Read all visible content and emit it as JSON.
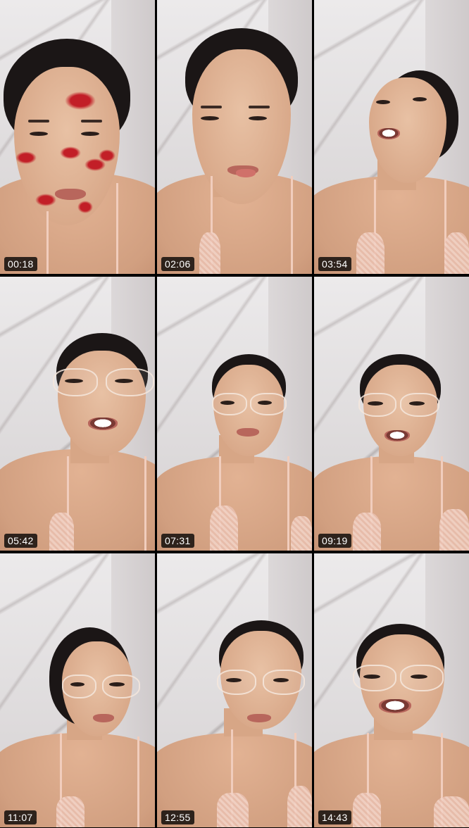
{
  "thumbnails": [
    {
      "timestamp": "00:18",
      "variant": "kiss-filter"
    },
    {
      "timestamp": "02:06",
      "variant": "tongue"
    },
    {
      "timestamp": "03:54",
      "variant": "looking-up"
    },
    {
      "timestamp": "05:42",
      "variant": "glasses-talking"
    },
    {
      "timestamp": "07:31",
      "variant": "glasses"
    },
    {
      "timestamp": "09:19",
      "variant": "glasses-talking"
    },
    {
      "timestamp": "11:07",
      "variant": "glasses-side"
    },
    {
      "timestamp": "12:55",
      "variant": "glasses"
    },
    {
      "timestamp": "14:43",
      "variant": "glasses-smile"
    }
  ],
  "colors": {
    "background": "#000000",
    "badge_bg": "#000000",
    "badge_text": "#ffffff",
    "kiss_red": "#c21f27"
  }
}
